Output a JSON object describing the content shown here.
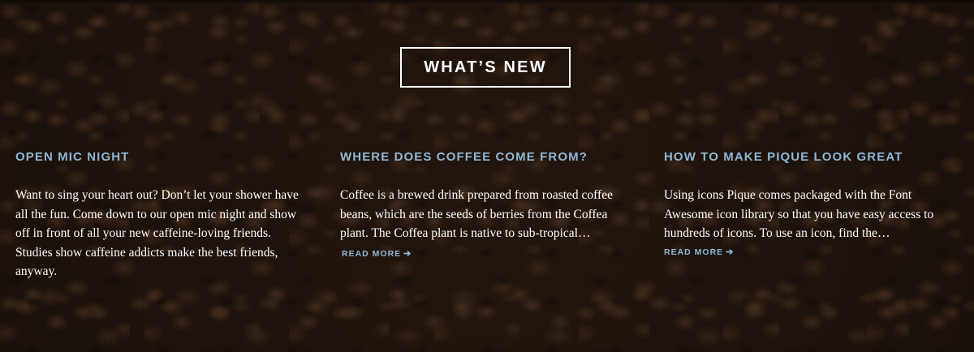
{
  "section": {
    "title": "WHAT’S NEW"
  },
  "posts": [
    {
      "title": "OPEN MIC NIGHT",
      "excerpt": "Want to sing your heart out? Don’t let your shower have all the fun. Come down to our open mic night and show off in front of all your new caffeine-loving friends. Studies show caffeine addicts make the best friends, anyway.",
      "read_more": ""
    },
    {
      "title": "WHERE DOES COFFEE COME FROM?",
      "excerpt": "Coffee is a brewed drink prepared from roasted coffee beans, which are the seeds of berries from the Coffea plant. The Coffea plant is native to sub-tropical…",
      "read_more": "READ MORE"
    },
    {
      "title": "HOW TO MAKE PIQUE LOOK GREAT",
      "excerpt": "Using icons Pique comes packaged with the Font Awesome icon library so that you have easy access to hundreds of icons. To use an icon, find the…",
      "read_more": "READ MORE"
    }
  ],
  "icons": {
    "read_more_arrow": "chevron-right-icon"
  },
  "colors": {
    "accent": "#8fb8d4",
    "text": "#ffffff",
    "background": "#24160f"
  }
}
